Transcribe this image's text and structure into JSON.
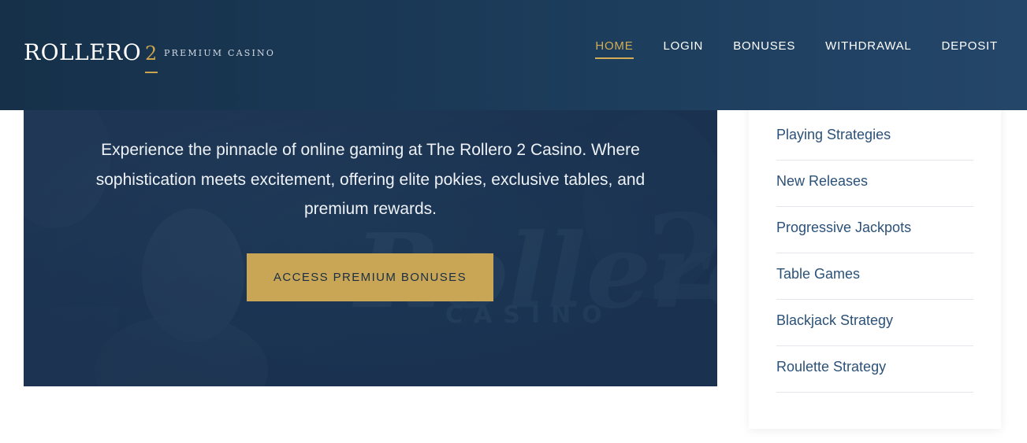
{
  "header": {
    "logo": {
      "name": "ROLLERO",
      "number": "2",
      "tagline": "PREMIUM CASINO"
    },
    "nav": [
      {
        "label": "HOME",
        "active": true
      },
      {
        "label": "LOGIN",
        "active": false
      },
      {
        "label": "BONUSES",
        "active": false
      },
      {
        "label": "WITHDRAWAL",
        "active": false
      },
      {
        "label": "DEPOSIT",
        "active": false
      }
    ]
  },
  "hero": {
    "description": "Experience the pinnacle of online gaming at The Rollero 2 Casino. Where sophistication meets excitement, offering elite pokies, exclusive tables, and premium rewards.",
    "cta_label": "ACCESS PREMIUM BONUSES"
  },
  "sidebar": {
    "items": [
      {
        "label": "Playing Strategies"
      },
      {
        "label": "New Releases"
      },
      {
        "label": "Progressive Jackpots"
      },
      {
        "label": "Table Games"
      },
      {
        "label": "Blackjack Strategy"
      },
      {
        "label": "Roulette Strategy"
      }
    ]
  },
  "colors": {
    "header_bg": "#1b3a58",
    "accent_gold": "#c9a655",
    "link_blue": "#2b5178",
    "hero_bg": "#1d3552"
  }
}
